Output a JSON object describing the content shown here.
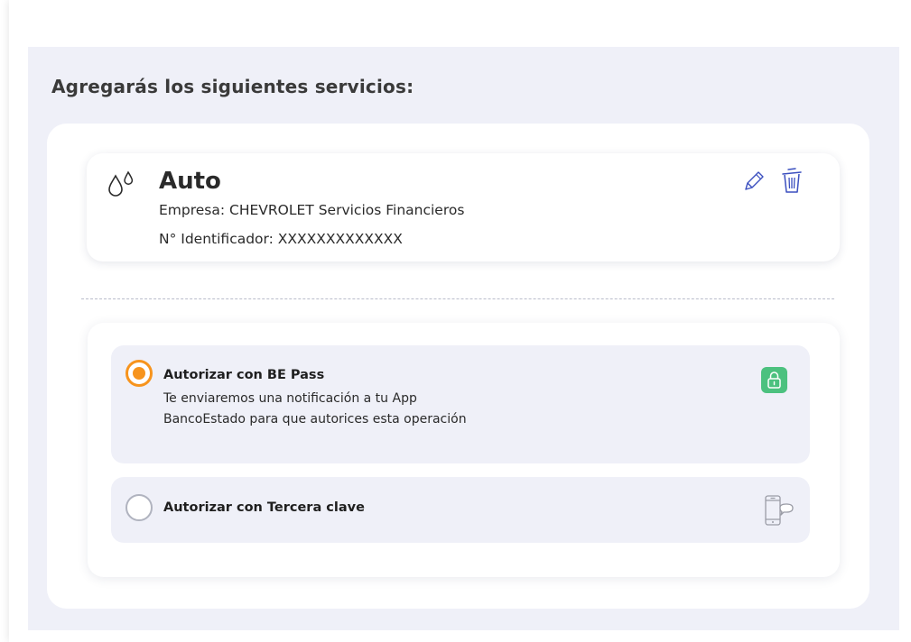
{
  "section": {
    "title": "Agregarás los siguientes servicios:"
  },
  "service": {
    "icon": "water-drops-icon",
    "name": "Auto",
    "company": "Empresa: CHEVROLET Servicios Financieros",
    "identifier": "N° Identificador: XXXXXXXXXXXXX",
    "actions": {
      "edit_icon": "pencil-icon",
      "delete_icon": "trash-icon"
    }
  },
  "authorization": {
    "options": [
      {
        "title": "Autorizar con BE Pass",
        "description_line1": "Te enviaremos una notificación a tu App",
        "description_line2": "BancoEstado para que autorices esta operación",
        "selected": true,
        "icon": "lock-icon"
      },
      {
        "title": "Autorizar con Tercera clave",
        "selected": false,
        "icon": "phone-message-icon"
      }
    ]
  },
  "colors": {
    "section_bg": "#eff0f8",
    "accent_orange": "#f7941d",
    "lock_green": "#4cc17f",
    "icon_blue": "#3b4fbf"
  }
}
